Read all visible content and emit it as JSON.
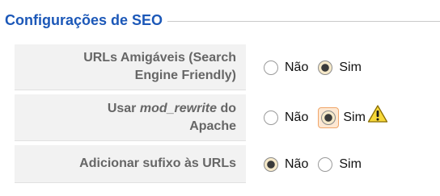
{
  "section": {
    "title": "Configurações de SEO"
  },
  "rows": [
    {
      "label_lines": [
        "URLs Amigáveis (Search",
        "Engine Friendly)"
      ],
      "options": [
        "Não",
        "Sim"
      ],
      "selected": "Sim"
    },
    {
      "label_line1_before": "Usar ",
      "label_line1_em": "mod_rewrite",
      "label_line1_after": " do",
      "label_line2": "Apache",
      "options": [
        "Não",
        "Sim"
      ],
      "selected": "Sim",
      "warning_icon": "warning-icon"
    },
    {
      "label_lines": [
        "Adicionar sufixo às URLs"
      ],
      "options": [
        "Não",
        "Sim"
      ],
      "selected": "Não"
    }
  ],
  "colors": {
    "title": "#1c58b8",
    "label_bg": "#f2f2f2",
    "label_text": "#666666",
    "focus_ring": "#f0a66a"
  }
}
